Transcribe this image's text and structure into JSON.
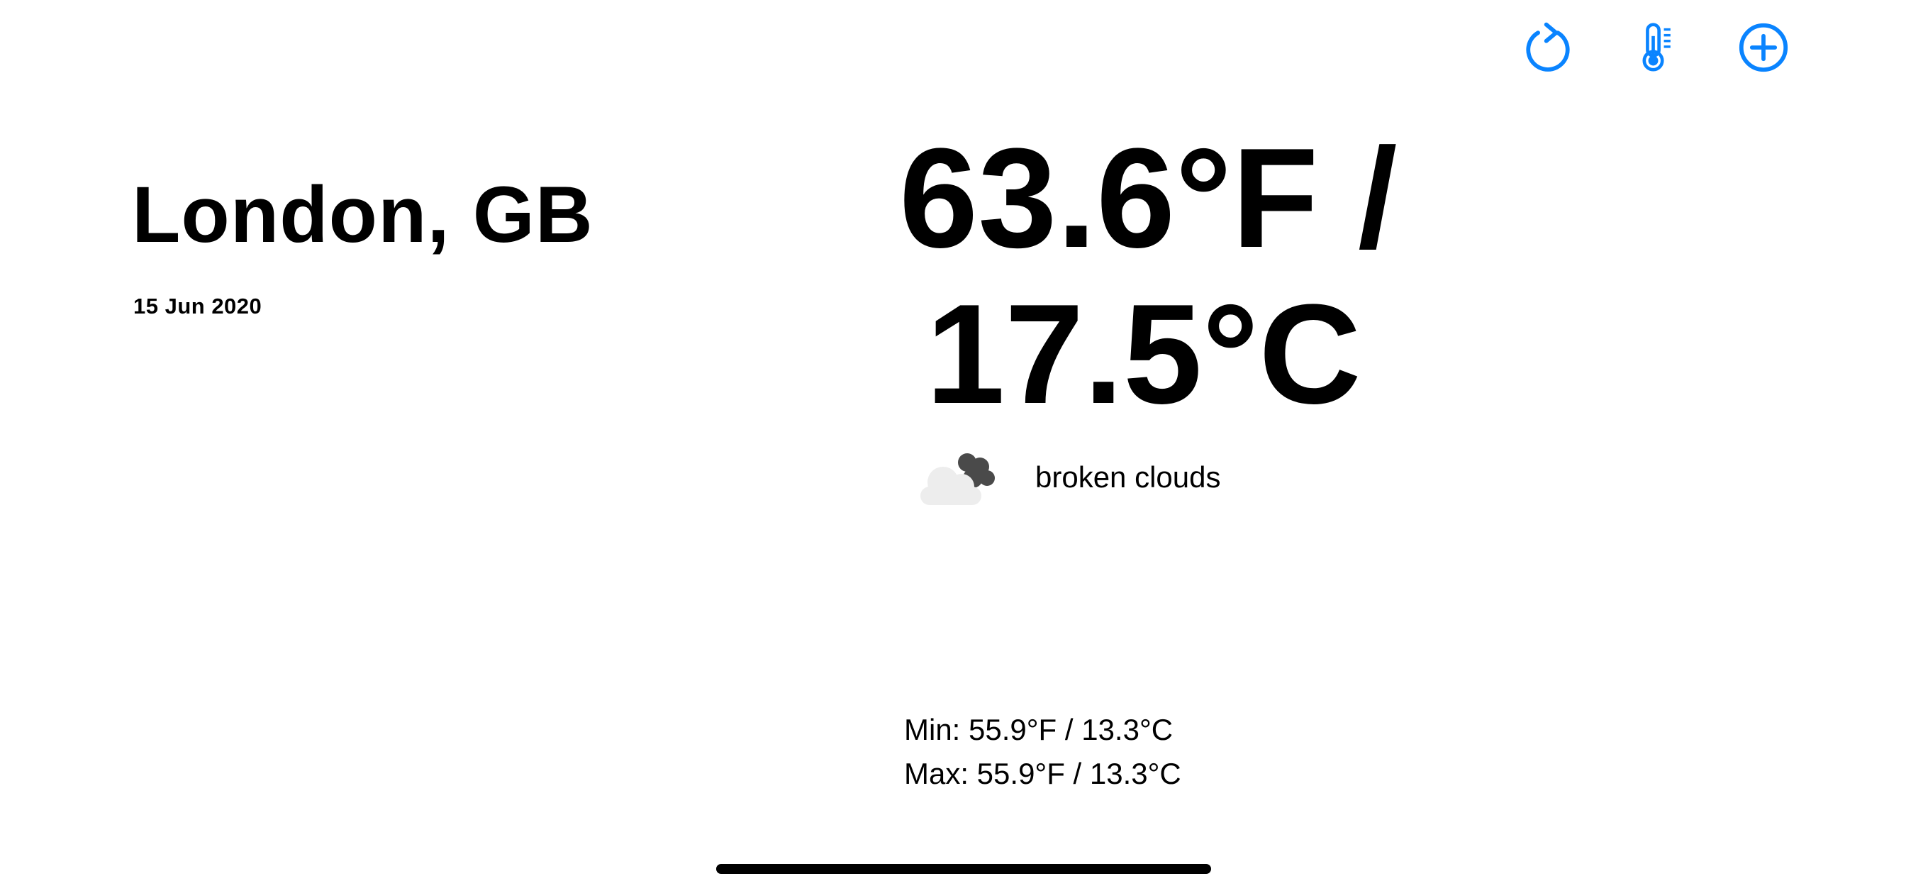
{
  "colors": {
    "accent": "#0A84FF",
    "text": "#000000",
    "background": "#FFFFFF",
    "cloud_light": "#EDEDED",
    "cloud_dark": "#4A4A4A"
  },
  "toolbar": {
    "refresh_icon": "arrow-clockwise-icon",
    "unit_icon": "thermometer-icon",
    "add_icon": "plus-circle-icon"
  },
  "location": {
    "city": "London, GB",
    "date": "15 Jun 2020"
  },
  "current": {
    "temp_line1": "63.6°F /",
    "temp_line2": "17.5°C",
    "condition_icon": "broken-clouds-icon",
    "condition": "broken clouds"
  },
  "range": {
    "min": "Min: 55.9°F / 13.3°C",
    "max": "Max: 55.9°F / 13.3°C"
  }
}
